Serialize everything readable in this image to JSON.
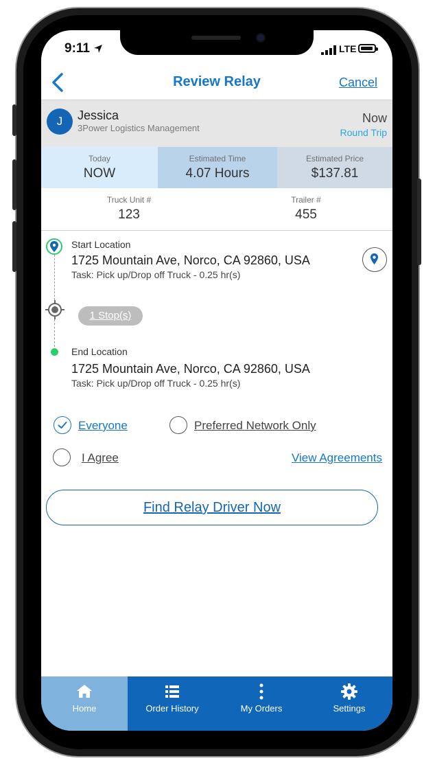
{
  "status_bar": {
    "time": "9:11",
    "network": "LTE"
  },
  "header": {
    "title": "Review Relay",
    "cancel_label": "Cancel"
  },
  "user": {
    "initial": "J",
    "name": "Jessica",
    "company": "3Power Logistics Management",
    "when": "Now",
    "trip_type": "Round Trip"
  },
  "summary": [
    {
      "label": "Today",
      "value": "NOW"
    },
    {
      "label": "Estimated Time",
      "value": "4.07 Hours"
    },
    {
      "label": "Estimated Price",
      "value": "$137.81"
    }
  ],
  "truck": {
    "unit_label": "Truck Unit #",
    "unit_value": "123",
    "trailer_label": "Trailer #",
    "trailer_value": "455"
  },
  "route": {
    "start": {
      "label": "Start Location",
      "address": "1725 Mountain Ave, Norco, CA 92860, USA",
      "task": "Task: Pick up/Drop off Truck - 0.25 hr(s)"
    },
    "stops_label": "1 Stop(s)",
    "end": {
      "label": "End Location",
      "address": "1725 Mountain Ave, Norco, CA 92860, USA",
      "task": "Task: Pick up/Drop off Truck - 0.25 hr(s)"
    }
  },
  "options": {
    "everyone": "Everyone",
    "preferred": "Preferred Network Only",
    "agree": "I Agree",
    "view_agreements": "View Agreements",
    "selected": "everyone"
  },
  "find_button": "Find Relay Driver Now",
  "tabs": [
    {
      "label": "Home",
      "icon": "home-icon"
    },
    {
      "label": "Order History",
      "icon": "list-icon"
    },
    {
      "label": "My Orders",
      "icon": "dots-vertical-icon"
    },
    {
      "label": "Settings",
      "icon": "gear-icon"
    }
  ],
  "colors": {
    "primary": "#1677c8",
    "tab_bar": "#1066b8",
    "tab_active": "#7fb3de",
    "trip_type": "#2aa6e0",
    "location_green": "#2ecc71"
  }
}
